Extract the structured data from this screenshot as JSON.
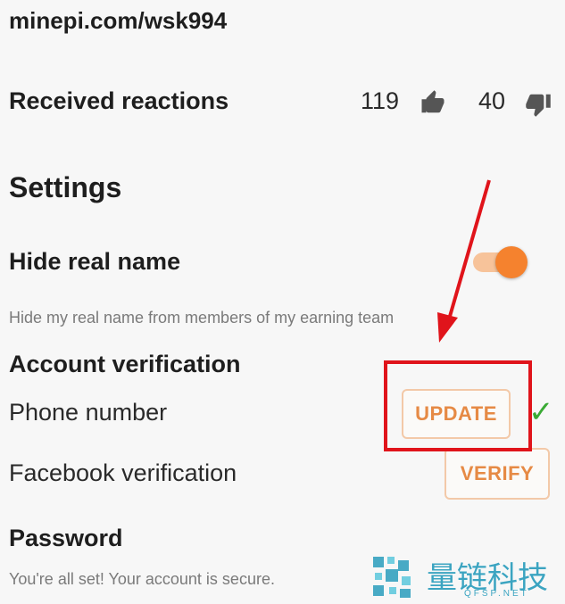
{
  "profile": {
    "url": "minepi.com/wsk994"
  },
  "reactions": {
    "label": "Received reactions",
    "likes": "119",
    "dislikes": "40"
  },
  "settings": {
    "title": "Settings",
    "hide_name": {
      "label": "Hide real name",
      "description": "Hide my real name from members of my earning team",
      "enabled": true
    }
  },
  "verification": {
    "title": "Account verification",
    "phone": {
      "label": "Phone number",
      "button": "UPDATE",
      "verified": true
    },
    "facebook": {
      "label": "Facebook verification",
      "button": "VERIFY"
    }
  },
  "password": {
    "title": "Password",
    "status": "You're all set! Your account is secure."
  },
  "watermark": {
    "text": "量链科技",
    "sub": "QFSP.NET"
  },
  "colors": {
    "accent": "#f5822e",
    "annotation": "#e0141b",
    "check": "#3aaa35"
  }
}
